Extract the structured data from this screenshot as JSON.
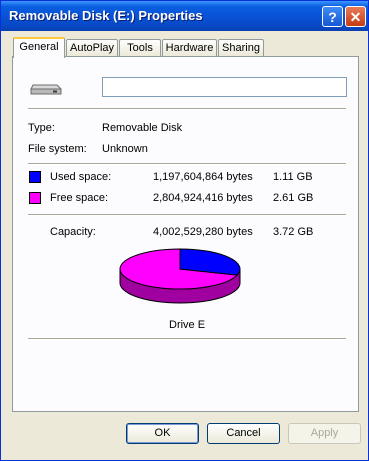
{
  "window": {
    "title": "Removable Disk (E:) Properties",
    "help_glyph": "?",
    "close_glyph": "✕"
  },
  "tabs": [
    {
      "label": "General",
      "active": true
    },
    {
      "label": "AutoPlay",
      "active": false
    },
    {
      "label": "Tools",
      "active": false
    },
    {
      "label": "Hardware",
      "active": false
    },
    {
      "label": "Sharing",
      "active": false
    }
  ],
  "general": {
    "drive_icon": "removable-drive-icon",
    "volume_label_value": "",
    "type_label": "Type:",
    "type_value": "Removable Disk",
    "fs_label": "File system:",
    "fs_value": "Unknown",
    "used_label": "Used space:",
    "used_bytes": "1,197,604,864 bytes",
    "used_size": "1.11 GB",
    "used_color": "#0000ff",
    "free_label": "Free space:",
    "free_bytes": "2,804,924,416 bytes",
    "free_size": "2.61 GB",
    "free_color": "#ff00ff",
    "capacity_label": "Capacity:",
    "capacity_bytes": "4,002,529,280 bytes",
    "capacity_size": "3.72 GB",
    "drive_caption": "Drive E",
    "used_fraction": 0.299
  },
  "buttons": {
    "ok": "OK",
    "cancel": "Cancel",
    "apply": "Apply"
  }
}
